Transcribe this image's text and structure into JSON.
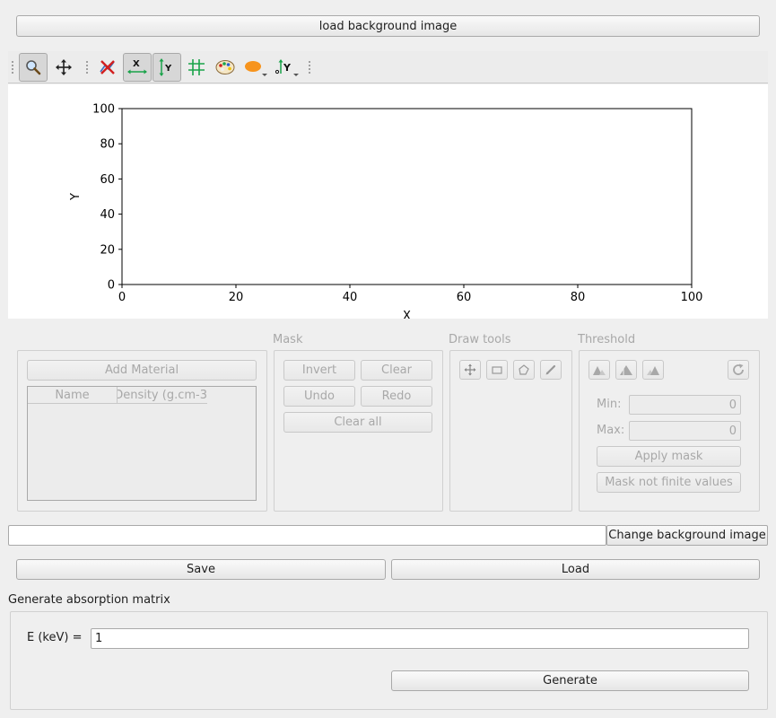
{
  "top": {
    "load_bg_label": "load background image"
  },
  "toolbar": {
    "tools": [
      "zoom-icon",
      "pan-icon",
      "clear-marker-icon",
      "x-axis-icon",
      "y-axis-icon",
      "grid-icon",
      "colormap-icon",
      "curve-style-icon",
      "y-axis-side-icon"
    ]
  },
  "plot": {
    "chart_data": {
      "type": "scatter",
      "series": [],
      "xlabel": "X",
      "ylabel": "Y",
      "xlim": [
        0,
        100
      ],
      "ylim": [
        0,
        100
      ],
      "xticks": [
        "0",
        "20",
        "40",
        "60",
        "80",
        "100"
      ],
      "yticks": [
        "0",
        "20",
        "40",
        "60",
        "80",
        "100"
      ],
      "grid": false
    }
  },
  "materials": {
    "add_label": "Add Material",
    "columns": [
      "Name",
      "Density (g.cm-3"
    ]
  },
  "mask": {
    "title": "Mask",
    "invert": "Invert",
    "clear": "Clear",
    "undo": "Undo",
    "redo": "Redo",
    "clear_all": "Clear all"
  },
  "draw": {
    "title": "Draw tools"
  },
  "threshold": {
    "title": "Threshold",
    "min_label": "Min:",
    "min_value": "0",
    "max_label": "Max:",
    "max_value": "0",
    "apply_mask": "Apply mask",
    "mask_not_finite": "Mask not finite values"
  },
  "background": {
    "path_value": "",
    "change_label": "Change background image"
  },
  "actions": {
    "save": "Save",
    "load": "Load"
  },
  "absorption": {
    "section_title": "Generate absorption matrix",
    "energy_label": "E (keV) =",
    "energy_value": "1",
    "generate": "Generate"
  },
  "colors": {
    "accent_green": "#1aa34a",
    "accent_orange": "#f7941d"
  }
}
